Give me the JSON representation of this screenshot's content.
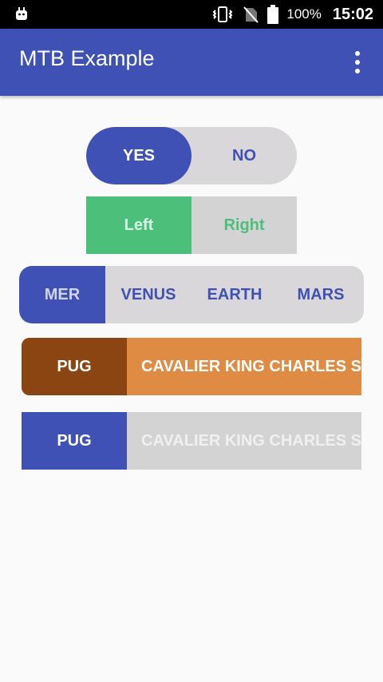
{
  "status_bar": {
    "battery": "100%",
    "time": "15:02",
    "icons": [
      "android-icon",
      "vibrate-icon",
      "no-signal-icon",
      "battery-icon"
    ]
  },
  "app_bar": {
    "title": "MTB Example",
    "menu_icon": "overflow-menu-icon",
    "color": "#3f51b5"
  },
  "toggle_yes_no": {
    "options": [
      "YES",
      "NO"
    ],
    "selected": "YES"
  },
  "toggle_left_right": {
    "options": [
      "Left",
      "Right"
    ],
    "selected": "Left",
    "accent": "#4cbf7a"
  },
  "planets": {
    "options": [
      "MER",
      "VENUS",
      "EARTH",
      "MARS"
    ],
    "selected": "MER"
  },
  "dogs_1": {
    "options": [
      "PUG",
      "CAVALIER KING CHARLES SP"
    ],
    "selected": "PUG",
    "selected_color": "#8b4513",
    "unselected_color": "#e08b43"
  },
  "dogs_2": {
    "options": [
      "PUG",
      "CAVALIER KING CHARLES SP"
    ],
    "selected": "PUG",
    "selected_color": "#3f51b5",
    "unselected_color": "#d3d3d3"
  }
}
